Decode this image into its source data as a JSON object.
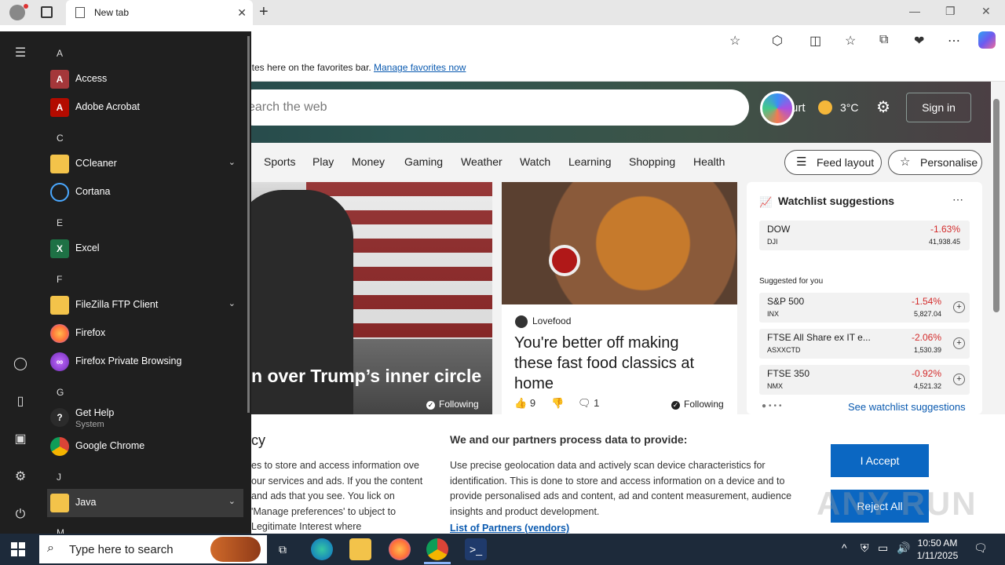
{
  "browser": {
    "tab_title": "New tab",
    "favbar_text": "ites here on the favorites bar.",
    "favbar_link": "Manage favorites now"
  },
  "newtab": {
    "search_placeholder": "earch the web",
    "location": "urt",
    "temperature": "3°C",
    "sign_in": "Sign in",
    "nav": [
      "Sports",
      "Play",
      "Money",
      "Gaming",
      "Weather",
      "Watch",
      "Learning",
      "Shopping",
      "Health"
    ],
    "feed_layout": "Feed layout",
    "personalise": "Personalise",
    "card1": {
      "headline": "n over Trump’s inner circle",
      "following": "Following"
    },
    "card2": {
      "source": "Lovefood",
      "headline": "You're better off making these fast food classics at home",
      "likes": "9",
      "comments": "1",
      "following": "Following"
    },
    "watchlist": {
      "title": "Watchlist suggestions",
      "suggested_label": "Suggested for you",
      "link": "See watchlist suggestions",
      "stocks": [
        {
          "name": "DOW",
          "symbol": "DJI",
          "change": "-1.63%",
          "value": "41,938.45"
        },
        {
          "name": "S&P 500",
          "symbol": "INX",
          "change": "-1.54%",
          "value": "5,827.04"
        },
        {
          "name": "FTSE All Share ex IT e...",
          "symbol": "ASXXCTD",
          "change": "-2.06%",
          "value": "1,530.39"
        },
        {
          "name": "FTSE 350",
          "symbol": "NMX",
          "change": "-0.92%",
          "value": "4,521.32"
        }
      ]
    }
  },
  "consent": {
    "left_heading": "cy",
    "left_text": "es to store and access information ove our services and ads. If you the content and ads that you see. You lick on 'Manage preferences' to ubject to Legitimate Interest where",
    "heading": "We and our partners process data to provide:",
    "body": "Use precise geolocation data and actively scan device characteristics for identification. This is done to store and access information on a device and to provide personalised ads and content, ad and content measurement, audience insights and product development.",
    "partners_link": "List of Partners (vendors)",
    "accept": "I Accept",
    "reject": "Reject All",
    "watermark": "ANY RUN"
  },
  "start_menu": {
    "letters": {
      "a": "A",
      "c": "C",
      "e": "E",
      "f": "F",
      "g": "G",
      "j": "J",
      "m": "M"
    },
    "apps": {
      "access": "Access",
      "acrobat": "Adobe Acrobat",
      "ccleaner": "CCleaner",
      "cortana": "Cortana",
      "excel": "Excel",
      "filezilla": "FileZilla FTP Client",
      "firefox": "Firefox",
      "firefox_private": "Firefox Private Browsing",
      "get_help": "Get Help",
      "get_help_sub": "System",
      "chrome": "Google Chrome",
      "java": "Java"
    }
  },
  "taskbar": {
    "search_placeholder": "Type here to search",
    "time": "10:50 AM",
    "date": "1/11/2025"
  }
}
